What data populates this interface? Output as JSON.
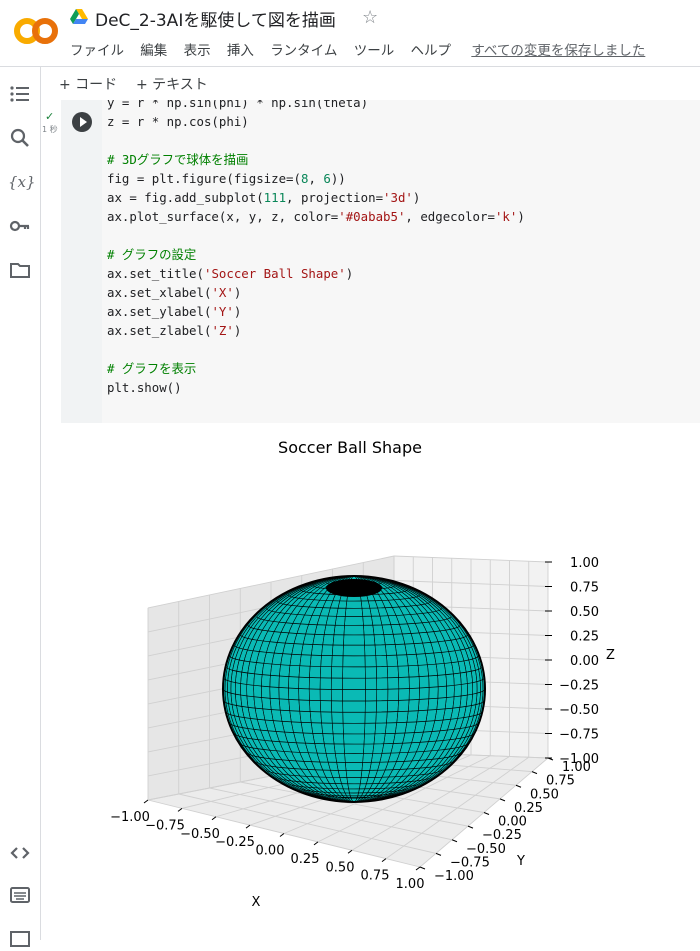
{
  "app": {
    "logo_text": "CO"
  },
  "document": {
    "title": "DeC_2-3AIを駆使して図を描画"
  },
  "menu": {
    "items": [
      "ファイル",
      "編集",
      "表示",
      "挿入",
      "ランタイム",
      "ツール",
      "ヘルプ"
    ],
    "save_status": "すべての変更を保存しました"
  },
  "toolbar": {
    "add_code": "+ コード",
    "add_text": "+ テキスト"
  },
  "sidebar": {
    "icons": [
      "toc-icon",
      "search-icon",
      "variables-icon",
      "key-icon",
      "folder-icon",
      "code-snippets-icon",
      "terminal-icon"
    ]
  },
  "cell": {
    "status_time": "1 秒",
    "code_lines": [
      "y = r * np.sin(phi) * np.sin(theta)",
      "z = r * np.cos(phi)",
      "",
      "# 3Dグラフで球体を描画",
      "fig = plt.figure(figsize=(8, 6))",
      "ax = fig.add_subplot(111, projection='3d')",
      "ax.plot_surface(x, y, z, color='#0abab5', edgecolor='k')",
      "",
      "# グラフの設定",
      "ax.set_title('Soccer Ball Shape')",
      "ax.set_xlabel('X')",
      "ax.set_ylabel('Y')",
      "ax.set_zlabel('Z')",
      "",
      "# グラフを表示",
      "plt.show()"
    ]
  },
  "chart_data": {
    "type": "surface3d",
    "title": "Soccer Ball Shape",
    "xlabel": "X",
    "ylabel": "Y",
    "zlabel": "Z",
    "surface_color": "#0abab5",
    "edge_color": "#000000",
    "xlim": [
      -1.0,
      1.0
    ],
    "ylim": [
      -1.0,
      1.0
    ],
    "zlim": [
      -1.0,
      1.0
    ],
    "x_ticks": [
      "−1.00",
      "−0.75",
      "−0.50",
      "−0.25",
      "0.00",
      "0.25",
      "0.50",
      "0.75",
      "1.00"
    ],
    "y_ticks": [
      "−1.00",
      "−0.75",
      "−0.50",
      "−0.25",
      "0.00",
      "0.25",
      "0.50",
      "0.75",
      "1.00"
    ],
    "z_ticks": [
      "−1.00",
      "−0.75",
      "−0.50",
      "−0.25",
      "0.00",
      "0.25",
      "0.50",
      "0.75",
      "1.00"
    ],
    "surface": "sphere radius 1"
  }
}
